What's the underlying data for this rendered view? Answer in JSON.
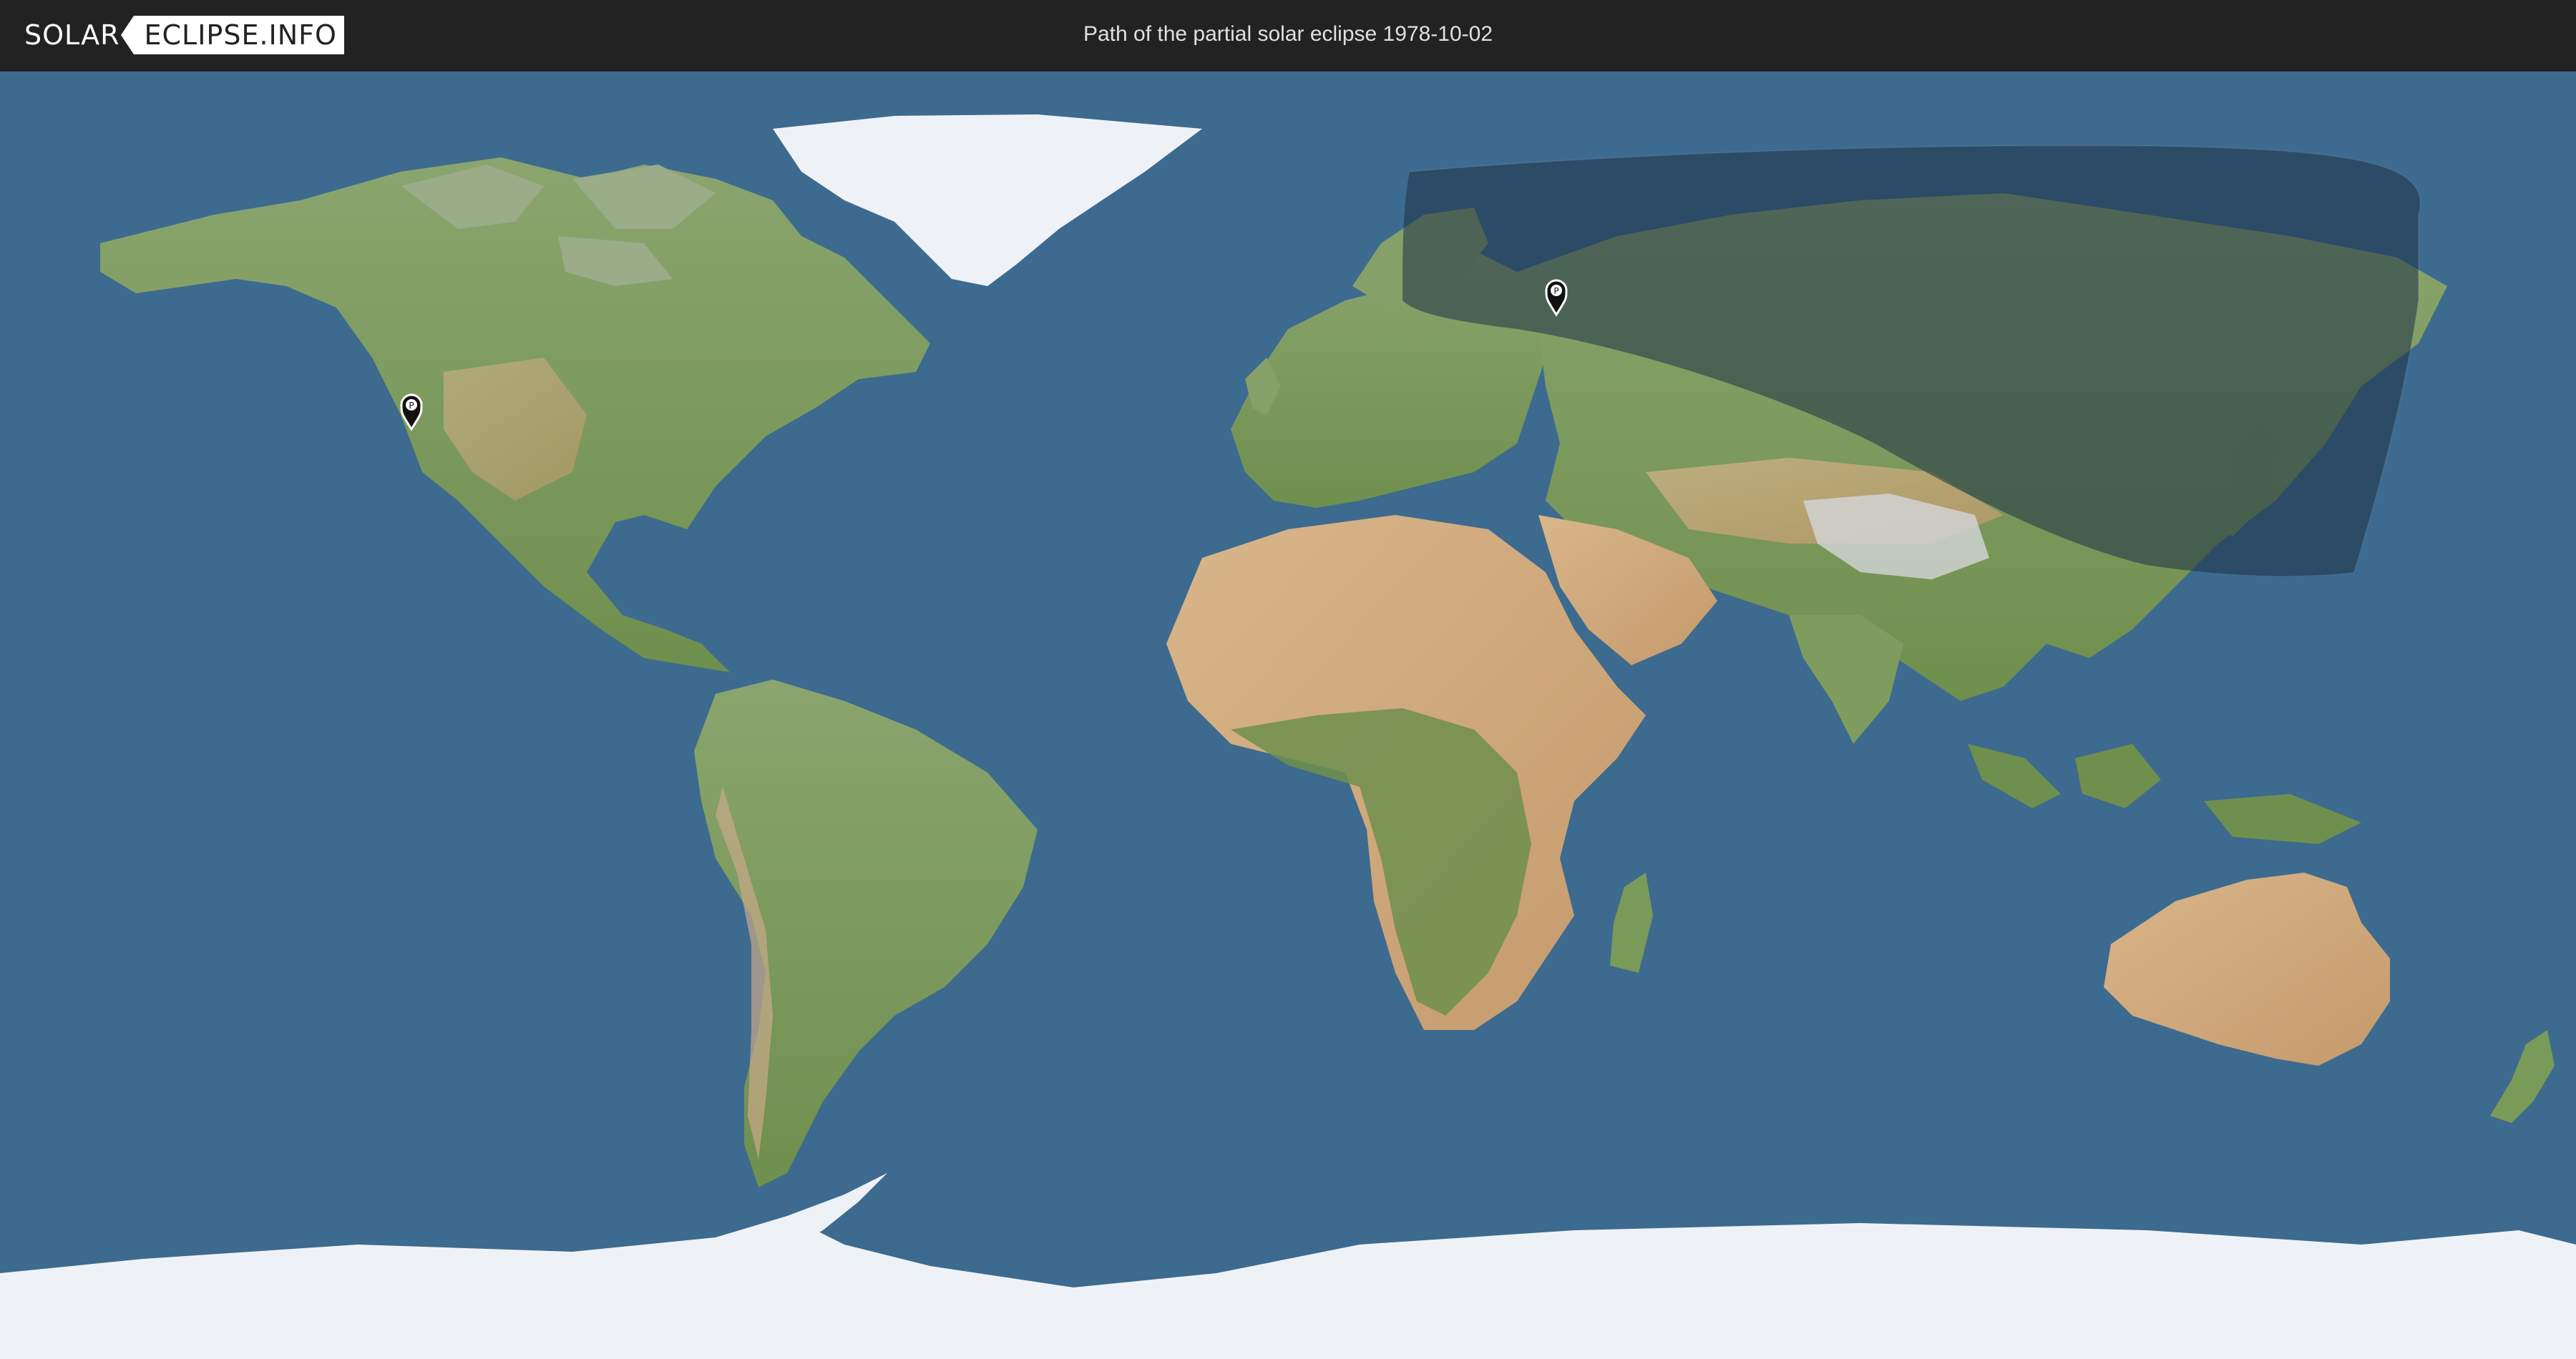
{
  "header": {
    "logo_left": "SOLAR",
    "logo_right": "ECLIPSE.INFO",
    "title": "Path of the partial solar eclipse 1978-10-02"
  },
  "map": {
    "projection": "equirectangular",
    "ocean_color": "#3d6a8f",
    "land_color": "#7c9a5c",
    "ice_color": "#eef2f7",
    "eclipse_shadow_color": "#1e3246",
    "markers": [
      {
        "label": "P",
        "place": "California coast"
      },
      {
        "label": "P",
        "place": "Western Russia"
      }
    ]
  },
  "colors": {
    "header_bg": "#222222",
    "header_text": "#e0e0e0",
    "logo_bg": "#ffffff"
  }
}
